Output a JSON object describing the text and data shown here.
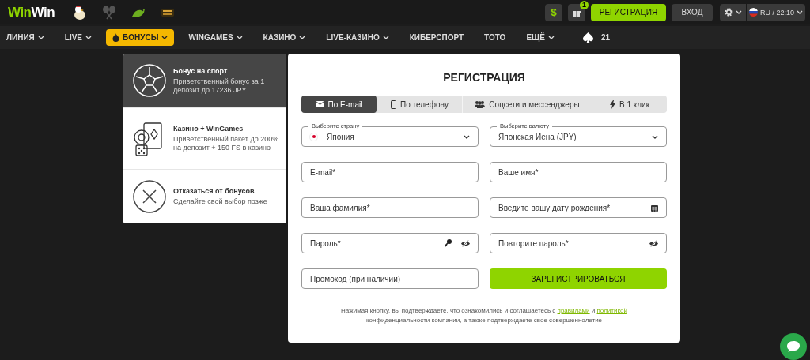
{
  "header": {
    "logo": [
      "Win",
      "Win"
    ],
    "gift_badge": "1",
    "currency_button": "$",
    "register_button": "РЕГИСТРАЦИЯ",
    "login_button": "ВХОД",
    "language": "RU / 22:10"
  },
  "nav": [
    {
      "label": "ЛИНИЯ",
      "kind": "menu",
      "selected": false
    },
    {
      "label": "LIVE",
      "kind": "menu",
      "selected": false
    },
    {
      "label": "БОНУСЫ",
      "kind": "bonus",
      "selected": true
    },
    {
      "label": "WINGAMES",
      "kind": "menu",
      "selected": false
    },
    {
      "label": "КАЗИНО",
      "kind": "menu",
      "selected": false
    },
    {
      "label": "LIVE-КАЗИНО",
      "kind": "menu",
      "selected": false
    },
    {
      "label": "КИБЕРСПОРТ",
      "kind": "link",
      "selected": false
    },
    {
      "label": "ТОТО",
      "kind": "link",
      "selected": false
    },
    {
      "label": "ЕЩЁ",
      "kind": "menu",
      "selected": false
    },
    {
      "label": "21",
      "kind": "poker",
      "selected": false
    }
  ],
  "bonus_menu": [
    {
      "kind": "sport",
      "title": "Бонус на спорт",
      "description": "Приветственный бонус за 1 депозит до 17236 JPY",
      "selected": true
    },
    {
      "kind": "casino",
      "title": "Казино + WinGames",
      "description": "Приветственный пакет до 200% на депозит + 150 FS в казино",
      "selected": false
    },
    {
      "kind": "decline",
      "title": "Отказаться от бонусов",
      "description": "Сделайте свой выбор позже",
      "selected": false
    }
  ],
  "registration": {
    "title": "РЕГИСТРАЦИЯ",
    "tabs": [
      {
        "kind": "email",
        "label": "По E-mail",
        "selected": true
      },
      {
        "kind": "phone",
        "label": "По телефону",
        "selected": false
      },
      {
        "kind": "social",
        "label": "Соцсети и мессенджеры",
        "selected": false
      },
      {
        "kind": "oneclick",
        "label": "В 1 клик",
        "selected": false
      }
    ],
    "fields": [
      {
        "kind": "country",
        "label": "Выберите страну",
        "value": "Япония"
      },
      {
        "kind": "select",
        "label": "Выберите валюту",
        "value": "Японская Иена (JPY)"
      },
      {
        "kind": "text",
        "placeholder": "E-mail*"
      },
      {
        "kind": "text",
        "placeholder": "Ваше имя*"
      },
      {
        "kind": "text",
        "placeholder": "Ваша фамилия*"
      },
      {
        "kind": "date",
        "placeholder": "Введите вашу дату рождения*"
      },
      {
        "kind": "password_generate",
        "placeholder": "Пароль*"
      },
      {
        "kind": "password",
        "placeholder": "Повторите пароль*"
      },
      {
        "kind": "text",
        "placeholder": "Промокод (при наличии)"
      }
    ],
    "submit_button": "ЗАРЕГИСТРИРОВАТЬСЯ",
    "disclaimer": {
      "before": "Нажимая кнопку, вы подтверждаете, что ознакомились и соглашаетесь с",
      "rules_link": "правилами",
      "and": "и",
      "policy_link": "политикой",
      "after": "конфиденциальности компании, а также подтверждаете свое совершеннолетие"
    }
  }
}
